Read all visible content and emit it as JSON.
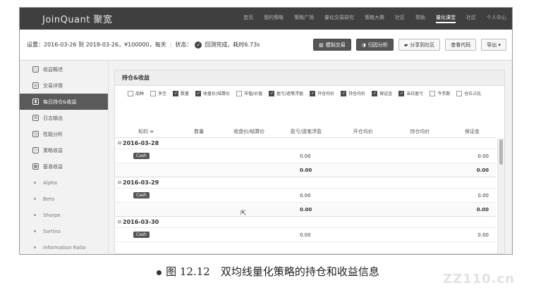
{
  "app": {
    "brand": "JoinQuant 聚宽",
    "nav": [
      "首页",
      "我的策略",
      "策略广场",
      "量化交易研究",
      "策略大赛",
      "社区",
      "帮助",
      "量化课堂",
      "社区",
      "个人中心"
    ]
  },
  "toolbar": {
    "settings": "设置：2016-03-26 到 2018-03-26，¥100000，每天",
    "status_label": "状态：",
    "status_text": "回测完成，耗时6.73s",
    "buttons": [
      "模拟交易",
      "归因分析",
      "分享到社区",
      "查看代码",
      "导出 ▾"
    ]
  },
  "sidebar": {
    "items": [
      {
        "label": "收益概述",
        "icon": "circle-icon"
      },
      {
        "label": "交易详情",
        "icon": "list-icon"
      },
      {
        "label": "每日持仓&收益",
        "icon": "chart-icon"
      },
      {
        "label": "日志输出",
        "icon": "log-icon"
      },
      {
        "label": "性能分析",
        "icon": "clock-icon"
      },
      {
        "label": "策略收益",
        "icon": "bulb-icon"
      },
      {
        "label": "基准收益",
        "icon": "grid-icon"
      }
    ],
    "subitems": [
      "Alpha",
      "Beta",
      "Sharpe",
      "Sortino",
      "Information Ratio"
    ]
  },
  "panel": {
    "title": "持仓&收益",
    "checks": [
      {
        "label": "品种",
        "on": false
      },
      {
        "label": "多空",
        "on": false
      },
      {
        "label": "数量",
        "on": true
      },
      {
        "label": "收盘价/结算价",
        "on": true
      },
      {
        "label": "市值/价值",
        "on": false
      },
      {
        "label": "盈亏/逐笔浮盈",
        "on": true
      },
      {
        "label": "开仓均价",
        "on": true
      },
      {
        "label": "持仓均价",
        "on": true
      },
      {
        "label": "保证金",
        "on": true
      },
      {
        "label": "当日盈亏",
        "on": true
      },
      {
        "label": "今手数",
        "on": false
      },
      {
        "label": "仓位占比",
        "on": false
      }
    ],
    "columns": [
      "标的 ≑",
      "数量",
      "收盘价/结算价",
      "盈亏/逐笔浮盈",
      "开仓均价",
      "持仓均价",
      "保证金"
    ],
    "days": [
      {
        "date": "2016-03-28",
        "cash_label": "Cash",
        "cash_pnl": "0.00",
        "cash_margin": "0.00",
        "total_pnl": "0.00",
        "total_margin": "0.00"
      },
      {
        "date": "2016-03-29",
        "cash_label": "Cash",
        "cash_pnl": "0.00",
        "cash_margin": "0.00",
        "total_pnl": "0.00",
        "total_margin": "0.00"
      },
      {
        "date": "2016-03-30",
        "cash_label": "Cash",
        "cash_pnl": "0.00",
        "cash_margin": "0.00"
      }
    ]
  },
  "caption": "图 12.12　双均线量化策略的持仓和收益信息",
  "watermark": "ZZ110.cn"
}
